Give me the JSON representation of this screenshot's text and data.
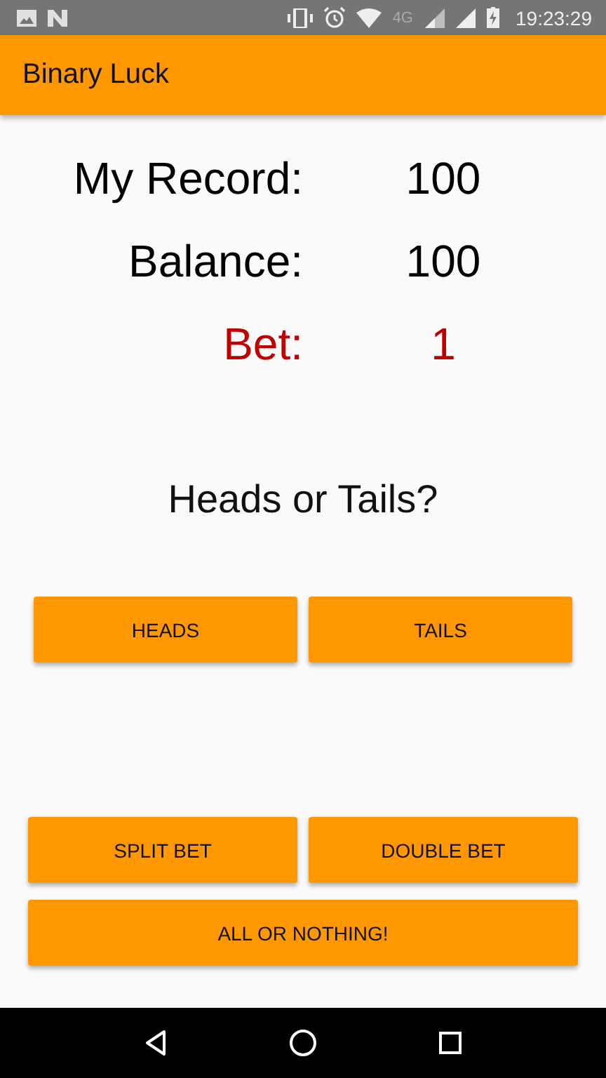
{
  "status_bar": {
    "network": "4G",
    "time": "19:23:29"
  },
  "app_bar": {
    "title": "Binary Luck"
  },
  "stats": [
    {
      "label": "My Record:",
      "value": "100",
      "color": "#000000"
    },
    {
      "label": "Balance:",
      "value": "100",
      "color": "#000000"
    },
    {
      "label": "Bet:",
      "value": "1",
      "color": "#c00000"
    }
  ],
  "prompt": "Heads or Tails?",
  "choice_buttons": [
    "HEADS",
    "TAILS"
  ],
  "bet_buttons": [
    "SPLIT BET",
    "DOUBLE BET"
  ],
  "all_in_button": "ALL OR NOTHING!"
}
